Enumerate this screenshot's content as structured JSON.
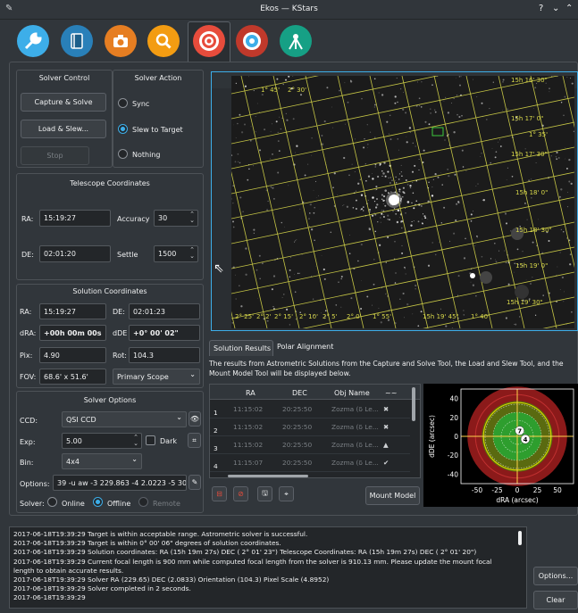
{
  "window": {
    "title": "Ekos — KStars",
    "help": "?",
    "minimize": "⌄",
    "maximize": "⌃"
  },
  "tabs": [
    {
      "name": "setup",
      "color": "#3daee9"
    },
    {
      "name": "scheduler",
      "color": "#2980b9"
    },
    {
      "name": "capture",
      "color": "#e67e22"
    },
    {
      "name": "focus",
      "color": "#f39c12"
    },
    {
      "name": "align",
      "color": "#e74c3c"
    },
    {
      "name": "guide",
      "color": "#c0392b"
    },
    {
      "name": "mount",
      "color": "#16a085"
    }
  ],
  "solver_control": {
    "title": "Solver Control",
    "capture_solve": "Capture & Solve",
    "load_slew": "Load & Slew...",
    "stop": "Stop"
  },
  "solver_action": {
    "title": "Solver Action",
    "sync": "Sync",
    "slew": "Slew to Target",
    "nothing": "Nothing"
  },
  "telescope": {
    "title": "Telescope Coordinates",
    "ra_label": "RA:",
    "ra": "15:19:27",
    "accuracy_label": "Accuracy",
    "accuracy": "30",
    "de_label": "DE:",
    "de": "02:01:20",
    "settle_label": "Settle",
    "settle": "1500"
  },
  "solution": {
    "title": "Solution Coordinates",
    "ra_label": "RA:",
    "ra": "15:19:27",
    "de_label": "DE:",
    "de": "02:01:23",
    "dra_label": "dRA:",
    "dra": "+00h 00m 00s",
    "dde_label": "dDE",
    "dde": "+0° 00' 02\"",
    "pix_label": "Pix:",
    "pix": "4.90",
    "rot_label": "Rot:",
    "rot": "104.3",
    "fov_label": "FOV:",
    "fov": "68.6' x 51.6'",
    "scope": "Primary Scope"
  },
  "solver_options": {
    "title": "Solver Options",
    "ccd_label": "CCD:",
    "ccd": "QSI CCD",
    "exp_label": "Exp:",
    "exp": "5.00",
    "dark_label": "Dark",
    "bin_label": "Bin:",
    "bin": "4x4",
    "options_label": "Options:",
    "options": "39 -u aw -3 229.863 -4 2.0223 -5 30",
    "solver_label": "Solver:",
    "online": "Online",
    "offline": "Offline",
    "remote": "Remote"
  },
  "image_labels": [
    {
      "text": "1° 45'",
      "color": "#d8d84a"
    },
    {
      "text": "2° 30'",
      "color": "#d8d84a"
    },
    {
      "text": "15h 16' 30\"",
      "color": "#d8d84a"
    },
    {
      "text": "15h 17' 0\"",
      "color": "#d8d84a"
    },
    {
      "text": "1° 35'",
      "color": "#d8d84a"
    },
    {
      "text": "15h 17' 30\"",
      "color": "#d8d84a"
    },
    {
      "text": "15h 18' 0\"",
      "color": "#d8d84a"
    },
    {
      "text": "15h 18' 30\"",
      "color": "#d8d84a"
    },
    {
      "text": "15h 19' 0\"",
      "color": "#d8d84a"
    },
    {
      "text": "15h 19' 30\"",
      "color": "#d8d84a"
    },
    {
      "text": "2° 25'",
      "color": "#d8d84a"
    },
    {
      "text": "2° 2'",
      "color": "#d8d84a"
    },
    {
      "text": "2° 15'",
      "color": "#d8d84a"
    },
    {
      "text": "2° 10'",
      "color": "#d8d84a"
    },
    {
      "text": "2° 5'",
      "color": "#d8d84a"
    },
    {
      "text": "2° 0'",
      "color": "#d8d84a"
    },
    {
      "text": "1° 55'",
      "color": "#d8d84a"
    },
    {
      "text": "15h 19' 45\"",
      "color": "#d8d84a"
    },
    {
      "text": "1° 40'",
      "color": "#d8d84a"
    }
  ],
  "results_tabs": {
    "results": "Solution Results",
    "polar": "Polar Alignment"
  },
  "results_desc": "The results from Astrometric Solutions from the Capture and Solve Tool, the Load and Slew Tool, and the Mount Model Tool will be displayed below.",
  "results_table": {
    "headers": [
      "RA",
      "DEC",
      "Obj Name",
      "~~"
    ],
    "rows": [
      {
        "n": "1",
        "ra": "11:15:02",
        "dec": "20:25:50",
        "obj": "Zozma (δ Le...",
        "status": "✖"
      },
      {
        "n": "2",
        "ra": "11:15:02",
        "dec": "20:25:50",
        "obj": "Zozma (δ Le...",
        "status": "✖"
      },
      {
        "n": "3",
        "ra": "11:15:02",
        "dec": "20:25:50",
        "obj": "Zozma (δ Le...",
        "status": "▲"
      },
      {
        "n": "4",
        "ra": "11:15:07",
        "dec": "20:25:50",
        "obj": "Zozma (δ Le...",
        "status": "✔"
      }
    ],
    "mount_model": "Mount Model"
  },
  "chart_data": {
    "type": "scatter",
    "xlabel": "dRA (arcsec)",
    "ylabel": "dDE (arcsec)",
    "xlim": [
      -70,
      70
    ],
    "ylim": [
      -50,
      50
    ],
    "xticks": [
      "-50",
      "-25",
      "0",
      "25",
      "50"
    ],
    "yticks": [
      "40",
      "20",
      "0",
      "-20",
      "-40"
    ],
    "points": [
      {
        "label": "7",
        "x": 3,
        "y": 6
      },
      {
        "label": "4",
        "x": 10,
        "y": -3
      }
    ],
    "colors": {
      "outer": "#8b1a1a",
      "mid": "#d4d400",
      "inner": "#2e9e2e",
      "axis": "#ffd24a"
    }
  },
  "log": [
    "2017-06-18T19:39:29 Target is within acceptable range. Astrometric solver is successful.",
    "2017-06-18T19:39:29 Target is within  0° 00' 06\" degrees of solution coordinates.",
    "2017-06-18T19:39:29 Solution coordinates: RA (15h 19m 27s) DEC ( 2° 01' 23\") Telescope Coordinates: RA (15h 19m 27s) DEC ( 2° 01' 20\")",
    "2017-06-18T19:39:29 Current focal length is 900 mm while computed focal length from the solver is 910.13 mm. Please update the mount focal length to obtain accurate results.",
    "2017-06-18T19:39:29 Solver RA (229.65) DEC (2.0833) Orientation (104.3) Pixel Scale (4.8952)",
    "2017-06-18T19:39:29 Solver completed in 2 seconds.",
    "2017-06-18T19:39:29"
  ],
  "buttons": {
    "options": "Options...",
    "clear": "Clear"
  }
}
